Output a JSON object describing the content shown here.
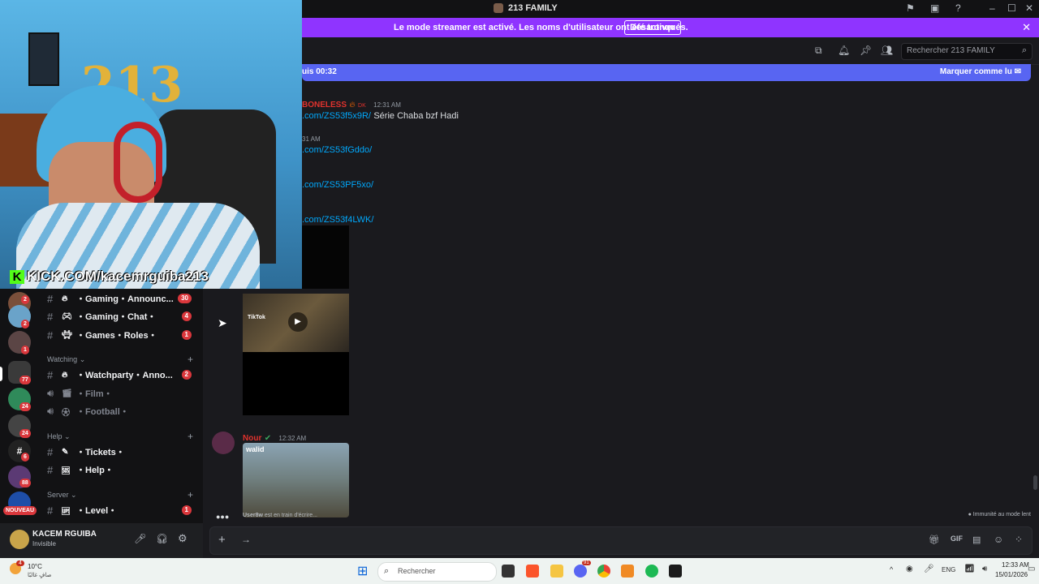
{
  "window": {
    "title": "213 FAMILY"
  },
  "banner": {
    "message": "Le mode streamer est activé. Les noms d'utilisateur ont été tronqués.",
    "disable_label": "Désactiver"
  },
  "header": {
    "search_placeholder": "Rechercher 213 FAMILY"
  },
  "new_messages": {
    "left_text": "uis 00:32",
    "mark_read": "Marquer comme lu"
  },
  "chat": {
    "messages": [
      {
        "author": "BONELESS",
        "author_suffix": "DK",
        "time": "12:31 AM",
        "link": ".com/ZS53f5x9R/",
        "text": "Série Chaba bzf Hadi"
      },
      {
        "time": "31 AM",
        "link": ".com/ZS53fGddo/"
      },
      {
        "link": ".com/ZS53PF5xo/"
      },
      {
        "link": ".com/ZS53f4LWK/"
      },
      {
        "author": "Nour",
        "time": "12:32 AM",
        "embed_label": "walid",
        "video_label": "TikTok"
      }
    ],
    "typing": {
      "user": "User8w",
      "text": "est en train d'écrire..."
    },
    "immunity": "Immunité au mode lent"
  },
  "webcam": {
    "caption": "KICK.COM/kacemrguiba213",
    "number": "213"
  },
  "servers": [
    {
      "badge": "2"
    },
    {
      "badge": "2"
    },
    {
      "badge": "1"
    },
    {
      "badge": "77"
    },
    {
      "badge": "24"
    },
    {
      "badge": "24"
    },
    {
      "badge": "6"
    },
    {
      "badge": "88"
    },
    {
      "badge": "NOUVEAU"
    }
  ],
  "channels": {
    "items": [
      {
        "name": "・Gaming・Announc...",
        "badge": "30"
      },
      {
        "name": "・Gaming・Chat・",
        "badge": "4"
      },
      {
        "name": "・Games・Roles・",
        "badge": "1"
      }
    ],
    "watching_label": "Watching",
    "watching": [
      {
        "name": "・Watchparty・Anno...",
        "badge": "2"
      },
      {
        "name": "・Film・"
      },
      {
        "name": "・Football・"
      }
    ],
    "help_label": "Help",
    "help": [
      {
        "name": "・Tickets・"
      },
      {
        "name": "・Help・"
      }
    ],
    "server_label": "Server",
    "server": [
      {
        "name": "・Level・",
        "badge": "1"
      }
    ]
  },
  "user": {
    "name": "KACEM RGUIBA",
    "status": "Invisible"
  },
  "taskbar": {
    "weather_temp": "10°C",
    "weather_desc": "صافٍ غالبًا",
    "weather_badge": "4",
    "search": "Rechercher",
    "lang": "ENG",
    "time": "12:33 AM",
    "date": "15/01/2026",
    "discord_badge": "91"
  }
}
